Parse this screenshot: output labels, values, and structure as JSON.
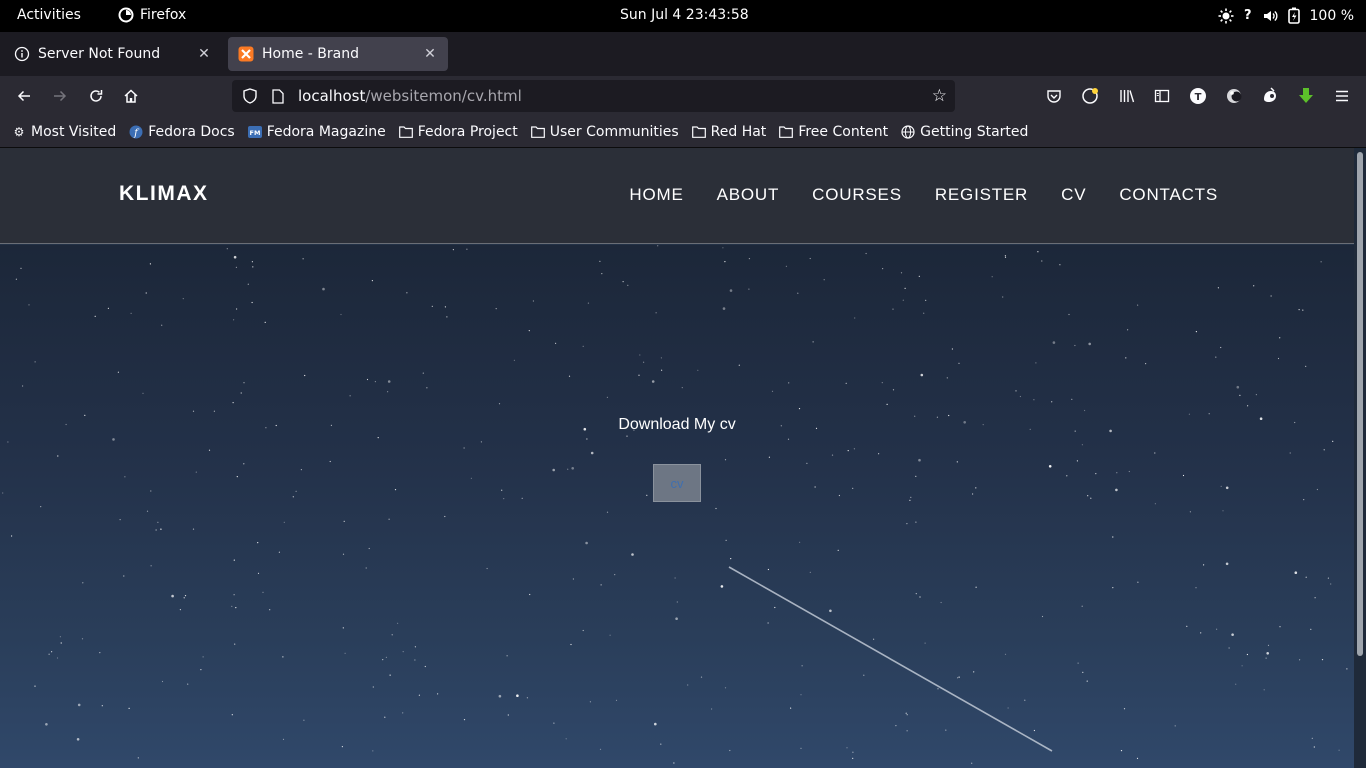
{
  "system": {
    "activities": "Activities",
    "app_name": "Firefox",
    "clock": "Sun Jul 4  23:43:58",
    "battery": "100 %"
  },
  "tabs": [
    {
      "title": "Server Not Found",
      "active": false,
      "icon": "info-icon"
    },
    {
      "title": "Home - Brand",
      "active": true,
      "icon": "xampp-icon"
    }
  ],
  "toolbar": {
    "url_host": "localhost",
    "url_path": "/websitemon/cv.html",
    "account_initial": "T"
  },
  "bookmarks": [
    {
      "label": "Most Visited",
      "icon": "gear-icon"
    },
    {
      "label": "Fedora Docs",
      "icon": "fedora-icon"
    },
    {
      "label": "Fedora Magazine",
      "icon": "fedora-magazine-icon"
    },
    {
      "label": "Fedora Project",
      "icon": "folder-icon"
    },
    {
      "label": "User Communities",
      "icon": "folder-icon"
    },
    {
      "label": "Red Hat",
      "icon": "folder-icon"
    },
    {
      "label": "Free Content",
      "icon": "folder-icon"
    },
    {
      "label": "Getting Started",
      "icon": "globe-icon"
    }
  ],
  "site": {
    "brand": "KLIMAX",
    "nav": [
      "HOME",
      "ABOUT",
      "COURSES",
      "REGISTER",
      "CV",
      "CONTACTS"
    ],
    "download_text": "Download My cv",
    "cv_button": "cv"
  },
  "colors": {
    "nav_bg": "#2b2f38",
    "hero_top": "#1c2739",
    "hero_bottom": "#30486a",
    "button_bg": "#6d7684"
  }
}
